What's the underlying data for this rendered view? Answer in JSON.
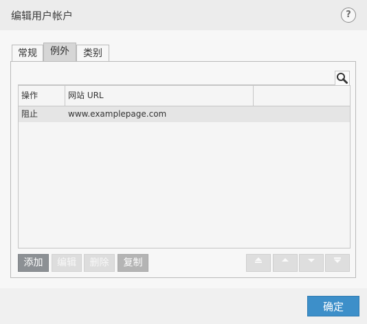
{
  "window": {
    "title": "编辑用户帐户",
    "help_label": "?"
  },
  "tabs": [
    {
      "label": "常规",
      "active": false
    },
    {
      "label": "例外",
      "active": true
    },
    {
      "label": "类别",
      "active": false
    }
  ],
  "table": {
    "columns": [
      "操作",
      "网站 URL",
      ""
    ],
    "rows": [
      {
        "action": "阻止",
        "url": "www.examplepage.com"
      }
    ]
  },
  "buttons": {
    "add": "添加",
    "edit": "编辑",
    "delete": "删除",
    "copy": "复制"
  },
  "move_buttons": [
    "move-top-icon",
    "move-up-icon",
    "move-down-icon",
    "move-bottom-icon"
  ],
  "footer": {
    "ok": "确定"
  },
  "colors": {
    "accent": "#3d8fc9"
  }
}
